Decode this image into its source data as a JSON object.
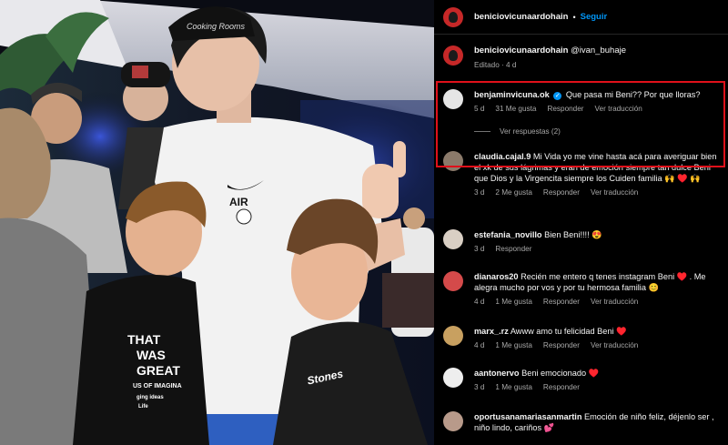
{
  "post": {
    "author": "beniciovicunaardohain",
    "follow_label": "Seguir",
    "dot": "•"
  },
  "caption": {
    "author": "beniciovicunaardohain",
    "text": "@ivan_buhaje",
    "meta": "Editado · 4 d"
  },
  "comments": [
    {
      "user": "benjaminvicuna.ok",
      "verified": true,
      "text": "Que pasa mi Beni?? Por que lloras?",
      "time": "5 d",
      "likes": "31 Me gusta",
      "reply": "Responder",
      "translate": "Ver traducción",
      "replies": "Ver respuestas (2)"
    },
    {
      "user": "claudia.cajal.9",
      "text": "Mi Vida yo me vine hasta acá para averiguar bien el xk de sus lágrimas y eran de emoción siempre tan dulce Beni que Dios y la Virgencita siempre los Cuiden familia 🙌 ♥️ 🙌",
      "time": "3 d",
      "likes": "2 Me gusta",
      "reply": "Responder",
      "translate": "Ver traducción"
    },
    {
      "user": "estefania_novillo",
      "text": "Bien Beni!!!! 😍",
      "time": "3 d",
      "reply": "Responder"
    },
    {
      "user": "dianaros20",
      "text": "Recién me entero q tenes instagram Beni ♥️ . Me alegra mucho por vos y por tu hermosa familia 😊",
      "time": "4 d",
      "likes": "1 Me gusta",
      "reply": "Responder",
      "translate": "Ver traducción"
    },
    {
      "user": "marx_.rz",
      "text": "Awww amo tu felicidad Beni ♥️",
      "time": "4 d",
      "likes": "1 Me gusta",
      "reply": "Responder",
      "translate": "Ver traducción"
    },
    {
      "user": "aantonervo",
      "text": "Beni emocionado ♥️",
      "time": "3 d",
      "likes": "1 Me gusta",
      "reply": "Responder"
    },
    {
      "user": "oportusanamariasanmartin",
      "text": "Emoción de niño feliz, déjenlo ser , niño lindo, cariños 💕"
    }
  ],
  "photo": {
    "cap_text": "Cooking Rooms",
    "shirt_brand": "AIR",
    "kid_shirt_1": "THAT",
    "kid_shirt_2": "WAS",
    "kid_shirt_3": "GREAT",
    "kid_shirt_4": "US OF IMAGINA",
    "kid_shirt_5": "ging ideas",
    "kid_shirt_6": "Life",
    "kid2_shirt": "Stones"
  },
  "colors": {
    "follow": "#0095f6",
    "highlight": "#e0101a",
    "muted": "#a8a8a8"
  }
}
